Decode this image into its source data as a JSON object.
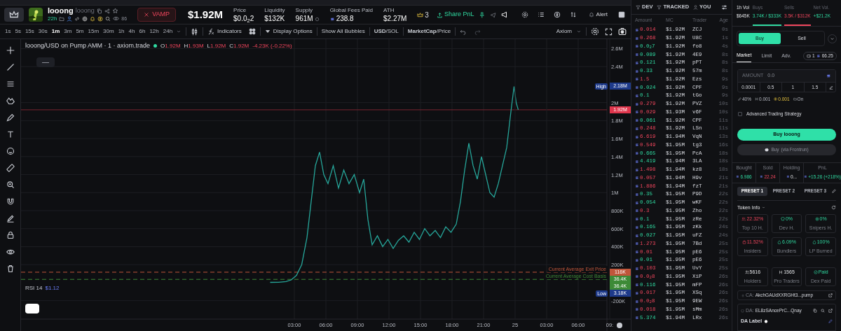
{
  "token": {
    "name": "looong",
    "ticker": "looong",
    "age": "22h",
    "watchers": "86",
    "vamp_label": "VAMP",
    "market_cap": "$1.92M"
  },
  "stats": [
    {
      "label": "Price",
      "value": "$0.0$_{2}$2",
      "kind": "plain"
    },
    {
      "label": "Liquidity",
      "value": "$132K",
      "kind": "plain"
    },
    {
      "label": "Supply",
      "value": "961M",
      "kind": "supply"
    },
    {
      "label": "Global Fees Paid",
      "value": "238.8",
      "kind": "sol"
    },
    {
      "label": "ATH",
      "value": "$2.27M",
      "kind": "plain"
    }
  ],
  "header_actions": {
    "crown_count": "3",
    "share": "Share PnL",
    "alert": "Alert"
  },
  "intervals": [
    {
      "label": "1s",
      "selected": false
    },
    {
      "label": "5s",
      "selected": false
    },
    {
      "label": "15s",
      "selected": false
    },
    {
      "label": "30s",
      "selected": false
    },
    {
      "label": "1m",
      "selected": true
    },
    {
      "label": "3m",
      "selected": false
    },
    {
      "label": "5m",
      "selected": false
    },
    {
      "label": "15m",
      "selected": false
    },
    {
      "label": "30m",
      "selected": false
    },
    {
      "label": "1h",
      "selected": false
    },
    {
      "label": "4h",
      "selected": false
    },
    {
      "label": "6h",
      "selected": false
    },
    {
      "label": "12h",
      "selected": false
    },
    {
      "label": "24h",
      "selected": false
    }
  ],
  "chart_toolbar": {
    "indicators": "Indicators",
    "display_options": "Display Options",
    "bubbles": "Show All Bubbles",
    "currency": "**USD**/SOL",
    "metric": "**MarketCap**/Price",
    "style": "Axiom"
  },
  "legend": {
    "title": "looong/USD on Pump AMM · 1 · axiom.trade",
    "ohlc": [
      {
        "key": "O",
        "value": "1.92M"
      },
      {
        "key": "H",
        "value": "1.93M"
      },
      {
        "key": "L",
        "value": "1.92M"
      },
      {
        "key": "C",
        "value": "1.92M"
      }
    ],
    "change": "-4.23K (-0.22%)"
  },
  "chart_data": {
    "type": "line",
    "grid": true,
    "x": [
      0.7,
      1.5,
      2.2,
      2.7,
      3.2,
      3.7,
      4.2,
      4.6,
      5.0,
      5.4,
      5.8,
      6.2,
      6.7,
      7.2,
      7.7,
      8.2,
      8.7,
      9.2,
      9.6,
      10.0,
      10.4,
      10.9,
      11.4,
      11.9,
      12.4,
      12.9,
      13.4,
      13.9,
      14.4,
      14.9,
      15.4,
      15.9,
      16.4,
      16.9,
      17.4,
      17.9,
      18.4,
      18.8,
      19.2,
      19.6,
      20.0,
      20.4,
      20.8,
      21.2,
      21.6,
      22.0,
      22.4,
      22.8,
      23.2,
      23.6,
      23.9,
      24.1,
      24.3
    ],
    "series": [
      {
        "color": "#26a69a",
        "values": [
          3180,
          5000,
          12000,
          30000,
          80000,
          200000,
          500000,
          900000,
          1300000,
          1450000,
          1200000,
          1100000,
          1300000,
          1050000,
          1250000,
          1100000,
          1200000,
          1000000,
          1150000,
          700000,
          420000,
          520000,
          400000,
          480000,
          380000,
          470000,
          520000,
          450000,
          560000,
          480000,
          600000,
          520000,
          580000,
          500000,
          620000,
          560000,
          650000,
          900000,
          1250000,
          1550000,
          1300000,
          1150000,
          1400000,
          1200000,
          1000000,
          950000,
          1100000,
          1300000,
          1500000,
          1900000,
          2180000,
          2000000,
          1920000
        ]
      }
    ],
    "xlim": [
      -23,
      35
    ],
    "ylim": [
      -405000,
      2704415
    ],
    "xticks": [
      {
        "value": 3,
        "label": "03:00"
      },
      {
        "value": 6,
        "label": "06:00"
      },
      {
        "value": 9,
        "label": "09:00"
      },
      {
        "value": 12,
        "label": "12:00"
      },
      {
        "value": 15,
        "label": "15:00"
      },
      {
        "value": 18,
        "label": "18:00"
      },
      {
        "value": 21,
        "label": "21:00"
      }
    ],
    "yticks": [
      {
        "value": 2600000,
        "label": "2.6M"
      },
      {
        "value": 2400000,
        "label": "2.4M"
      },
      {
        "value": 2000000,
        "label": "2M"
      },
      {
        "value": 1800000,
        "label": "1.8M"
      },
      {
        "value": 1600000,
        "label": "1.6M"
      },
      {
        "value": 1400000,
        "label": "1.4M"
      },
      {
        "value": 1200000,
        "label": "1.2M"
      },
      {
        "value": 1000000,
        "label": "1M"
      },
      {
        "value": 800000,
        "label": "800K"
      },
      {
        "value": 600000,
        "label": "600K"
      },
      {
        "value": 400000,
        "label": "400K"
      },
      {
        "value": 200000,
        "label": "200K"
      },
      {
        "value": -200000,
        "label": "-200K"
      }
    ],
    "ref_lines": [
      {
        "axis": "y",
        "value": 1920000,
        "color": "#7a2430"
      },
      {
        "axis": "y",
        "value": 116000,
        "label": "Current Average Exit Price",
        "color": "#c0563b"
      },
      {
        "axis": "y",
        "value": 36400,
        "label": "Current Average Cost Basis",
        "color": "#3d8a37"
      }
    ],
    "annotations": [
      {
        "text": "High",
        "y": 2180000
      },
      {
        "text": "2.18M",
        "y": 2180000
      },
      {
        "text": "1.92M",
        "y": 1920000
      },
      {
        "text": "116K",
        "y": 116000
      },
      {
        "text": "36.4K",
        "y": 36400
      },
      {
        "text": "36.4K"
      },
      {
        "text": "Low",
        "y": 3180
      },
      {
        "text": "3.18K"
      }
    ]
  },
  "next_day_time_labels": [
    "25",
    "03:00",
    "06:00",
    "09:"
  ],
  "rsi": {
    "label": "RSI 14",
    "value": "$1.12"
  },
  "trade_filters": [
    {
      "label": "DEV"
    },
    {
      "label": "TRACKED"
    },
    {
      "label": "YOU"
    }
  ],
  "trade_columns": [
    "Amount",
    "MC",
    "Trader",
    "Age"
  ],
  "trades": [
    {
      "amount": "0.014",
      "sell": true,
      "mc": "$1.92M",
      "trader": "ZCJ",
      "age": "0s"
    },
    {
      "amount": "0.268",
      "sell": true,
      "mc": "$1.92M",
      "trader": "U8C",
      "age": "1s"
    },
    {
      "amount": "0.0$_{2}$7",
      "sell": false,
      "mc": "$1.92M",
      "trader": "fo8",
      "age": "4s"
    },
    {
      "amount": "0.089",
      "sell": false,
      "mc": "$1.92M",
      "trader": "4E9",
      "age": "8s"
    },
    {
      "amount": "0.121",
      "sell": false,
      "mc": "$1.92M",
      "trader": "pPT",
      "age": "8s"
    },
    {
      "amount": "0.33",
      "sell": false,
      "mc": "$1.92M",
      "trader": "57m",
      "age": "8s"
    },
    {
      "amount": "1.5",
      "sell": true,
      "mc": "$1.92M",
      "trader": "Ezs",
      "age": "9s"
    },
    {
      "amount": "0.024",
      "sell": false,
      "mc": "$1.92M",
      "trader": "CPF",
      "age": "9s"
    },
    {
      "amount": "0.1",
      "sell": false,
      "mc": "$1.92M",
      "trader": "tGo",
      "age": "9s"
    },
    {
      "amount": "0.279",
      "sell": true,
      "mc": "$1.92M",
      "trader": "PVZ",
      "age": "10s"
    },
    {
      "amount": "0.029",
      "sell": true,
      "mc": "$1.93M",
      "trader": "v6F",
      "age": "10s"
    },
    {
      "amount": "0.061",
      "sell": false,
      "mc": "$1.92M",
      "trader": "CPF",
      "age": "11s"
    },
    {
      "amount": "0.248",
      "sell": true,
      "mc": "$1.92M",
      "trader": "LSn",
      "age": "11s"
    },
    {
      "amount": "6.619",
      "sell": true,
      "mc": "$1.94M",
      "trader": "VqN",
      "age": "13s"
    },
    {
      "amount": "0.549",
      "sell": true,
      "mc": "$1.95M",
      "trader": "tg3",
      "age": "16s"
    },
    {
      "amount": "0.665",
      "sell": false,
      "mc": "$1.95M",
      "trader": "PcA",
      "age": "18s"
    },
    {
      "amount": "4.419",
      "sell": false,
      "mc": "$1.94M",
      "trader": "3LA",
      "age": "18s"
    },
    {
      "amount": "1.498",
      "sell": true,
      "mc": "$1.94M",
      "trader": "kz8",
      "age": "18s"
    },
    {
      "amount": "0.057",
      "sell": true,
      "mc": "$1.94M",
      "trader": "H9v",
      "age": "21s"
    },
    {
      "amount": "1.886",
      "sell": true,
      "mc": "$1.94M",
      "trader": "fzT",
      "age": "21s"
    },
    {
      "amount": "0.35",
      "sell": false,
      "mc": "$1.95M",
      "trader": "P9D",
      "age": "22s"
    },
    {
      "amount": "0.054",
      "sell": false,
      "mc": "$1.95M",
      "trader": "wKF",
      "age": "22s"
    },
    {
      "amount": "0.3",
      "sell": true,
      "mc": "$1.95M",
      "trader": "Zho",
      "age": "22s"
    },
    {
      "amount": "0.1",
      "sell": false,
      "mc": "$1.95M",
      "trader": "zRe",
      "age": "22s"
    },
    {
      "amount": "0.165",
      "sell": false,
      "mc": "$1.95M",
      "trader": "zKk",
      "age": "24s"
    },
    {
      "amount": "0.027",
      "sell": false,
      "mc": "$1.95M",
      "trader": "uFZ",
      "age": "24s"
    },
    {
      "amount": "1.273",
      "sell": true,
      "mc": "$1.95M",
      "trader": "7Bd",
      "age": "25s"
    },
    {
      "amount": "0.01",
      "sell": true,
      "mc": "$1.95M",
      "trader": "pE6",
      "age": "25s"
    },
    {
      "amount": "0.01",
      "sell": false,
      "mc": "$1.95M",
      "trader": "pE6",
      "age": "25s"
    },
    {
      "amount": "0.103",
      "sell": true,
      "mc": "$1.95M",
      "trader": "UvY",
      "age": "25s"
    },
    {
      "amount": "0.0$_{2}$8",
      "sell": true,
      "mc": "$1.95M",
      "trader": "XiP",
      "age": "26s"
    },
    {
      "amount": "0.116",
      "sell": false,
      "mc": "$1.95M",
      "trader": "mFP",
      "age": "26s"
    },
    {
      "amount": "0.017",
      "sell": true,
      "mc": "$1.95M",
      "trader": "XSq",
      "age": "26s"
    },
    {
      "amount": "0.0$_{2}$8",
      "sell": true,
      "mc": "$1.95M",
      "trader": "9EW",
      "age": "26s"
    },
    {
      "amount": "0.018",
      "sell": true,
      "mc": "$1.95M",
      "trader": "sMm",
      "age": "26s"
    },
    {
      "amount": "5.374",
      "sell": false,
      "mc": "$1.94M",
      "trader": "LRx",
      "age": "26s"
    }
  ],
  "volume": [
    {
      "label": "1h Vol",
      "value": "$645K",
      "kind": "neutral"
    },
    {
      "label": "Buys",
      "value": "3.74K / $333K",
      "kind": "buy"
    },
    {
      "label": "Sells",
      "value": "3.5K / $312K",
      "kind": "sell"
    },
    {
      "label": "Net Vol.",
      "value": "+$21.2K",
      "kind": "buy"
    }
  ],
  "trade_side": [
    {
      "label": "Buy",
      "selected": true
    },
    {
      "label": "Sell",
      "selected": false
    }
  ],
  "order_types": [
    {
      "label": "Market",
      "selected": true
    },
    {
      "label": "Limit",
      "selected": false
    },
    {
      "label": "Adv.",
      "selected": false
    }
  ],
  "wallet": {
    "count": "1",
    "balance": "66.25"
  },
  "amount_field": {
    "label": "AMOUNT",
    "placeholder": "0.0"
  },
  "quick_amounts": [
    "0.0001",
    "0.5",
    "1",
    "1.5"
  ],
  "settings": {
    "slippage": "40%",
    "priority": "0.001",
    "bribe": "0.001",
    "mev": "On"
  },
  "advanced": {
    "label": "Advanced Trading Strategy",
    "checked": false
  },
  "buy_button": "Buy looong",
  "frontrun_button": {
    "label": "Buy",
    "note": "(via Frontrun)"
  },
  "position": [
    {
      "label": "Bought",
      "value": "6.986",
      "kind": "buy"
    },
    {
      "label": "Sold",
      "value": "22.24",
      "kind": "sell"
    },
    {
      "label": "Holding",
      "value": "0...",
      "kind": "neutral"
    },
    {
      "label": "PnL",
      "value": "+15.26 (+218%)",
      "kind": "buy"
    }
  ],
  "presets": [
    {
      "label": "PRESET 1",
      "selected": true
    },
    {
      "label": "PRESET 2",
      "selected": false
    },
    {
      "label": "PRESET 3",
      "selected": false
    }
  ],
  "token_info_title": "Token Info",
  "token_info": [
    {
      "value": "22.32%",
      "label": "Top 10 H.",
      "kind": "bad"
    },
    {
      "value": "0%",
      "label": "Dev H.",
      "kind": "good"
    },
    {
      "value": "0%",
      "label": "Snipers H.",
      "kind": "good"
    },
    {
      "value": "11.52%",
      "label": "Insiders",
      "kind": "bad"
    },
    {
      "value": "6.09%",
      "label": "Bundlers",
      "kind": "good"
    },
    {
      "value": "100%",
      "label": "LP Burned",
      "kind": "good"
    },
    {
      "value": "5616",
      "label": "Holders",
      "kind": "neutral"
    },
    {
      "value": "1565",
      "label": "Pro Traders",
      "kind": "neutral"
    },
    {
      "value": "Paid",
      "label": "Dex Paid",
      "kind": "good"
    }
  ],
  "contract": {
    "label": "CA:",
    "value": "AkchGAUdXXRGHt3...pump"
  },
  "deployer": {
    "label": "DA:",
    "value": "EL8zSAncePrC...Qnay",
    "tag_label": "DA Label"
  }
}
